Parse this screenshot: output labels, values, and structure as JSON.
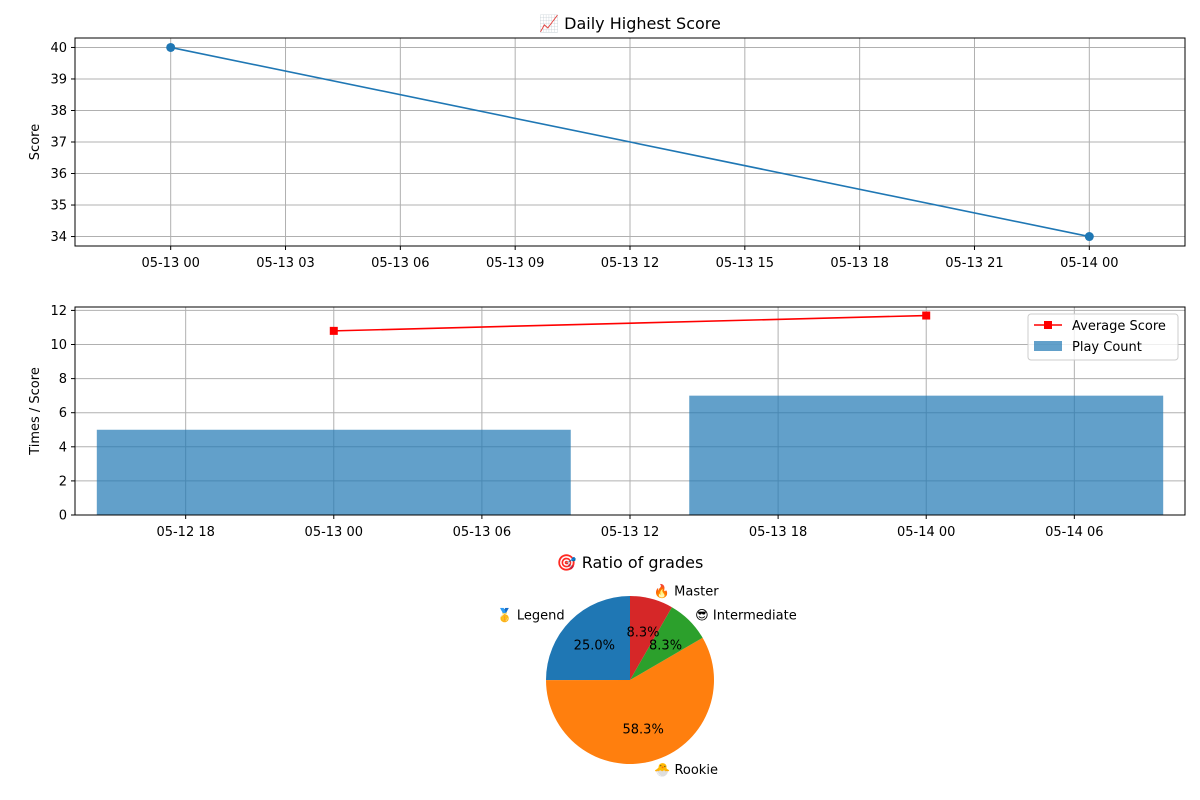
{
  "chart_data": [
    {
      "type": "line",
      "title": "📈 Daily Highest Score",
      "xlabel": "",
      "ylabel": "Score",
      "x": [
        "2024-05-13 00:00",
        "2024-05-14 00:00"
      ],
      "series": [
        {
          "values": [
            40,
            34
          ],
          "color": "#1f77b4",
          "marker": "circle"
        }
      ],
      "xlim": [
        "2024-05-12 21:30",
        "2024-05-14 02:30"
      ],
      "ylim": [
        33.7,
        40.3
      ],
      "yticks": [
        34,
        35,
        36,
        37,
        38,
        39,
        40
      ],
      "xticks": [
        "2024-05-13 00:00",
        "2024-05-13 03:00",
        "2024-05-13 06:00",
        "2024-05-13 09:00",
        "2024-05-13 12:00",
        "2024-05-13 15:00",
        "2024-05-13 18:00",
        "2024-05-13 21:00",
        "2024-05-14 00:00"
      ],
      "xtick_labels": [
        "05-13 00",
        "05-13 03",
        "05-13 06",
        "05-13 09",
        "05-13 12",
        "05-13 15",
        "05-13 18",
        "05-13 21",
        "05-14 00"
      ],
      "grid": true
    },
    {
      "type": "bar",
      "title": "",
      "xlabel": "",
      "ylabel": "Times / Score",
      "categories": [
        "2024-05-13 00:00",
        "2024-05-14 00:00"
      ],
      "series": [
        {
          "name": "Play Count",
          "type": "bar",
          "values": [
            5,
            7
          ],
          "color": "#1f77b4",
          "opacity": 0.7,
          "width_hours": 19.2
        },
        {
          "name": "Average Score",
          "type": "line",
          "values": [
            10.8,
            11.7
          ],
          "color": "#ff0000",
          "marker": "square"
        }
      ],
      "xlim": [
        "2024-05-12 13:31",
        "2024-05-14 10:29"
      ],
      "ylim": [
        0,
        12.2
      ],
      "yticks": [
        0,
        2,
        4,
        6,
        8,
        10,
        12
      ],
      "xticks": [
        "2024-05-12 18:00",
        "2024-05-13 00:00",
        "2024-05-13 06:00",
        "2024-05-13 12:00",
        "2024-05-13 18:00",
        "2024-05-14 00:00",
        "2024-05-14 06:00"
      ],
      "xtick_labels": [
        "05-12 18",
        "05-13 00",
        "05-13 06",
        "05-13 12",
        "05-13 18",
        "05-14 00",
        "05-14 06"
      ],
      "legend_placement": "top-right",
      "grid": true
    },
    {
      "type": "pie",
      "title": "🎯 Ratio of grades",
      "slices": [
        {
          "label": "🥇 Legend",
          "value": 25.0,
          "pct_label": "25.0%",
          "color": "#1f77b4"
        },
        {
          "label": "🐣 Rookie",
          "value": 58.3,
          "pct_label": "58.3%",
          "color": "#ff7f0e"
        },
        {
          "label": "😎 Intermediate",
          "value": 8.3,
          "pct_label": "8.3%",
          "color": "#2ca02c"
        },
        {
          "label": "🔥 Master",
          "value": 8.3,
          "pct_label": "8.3%",
          "color": "#d62728"
        }
      ]
    }
  ]
}
